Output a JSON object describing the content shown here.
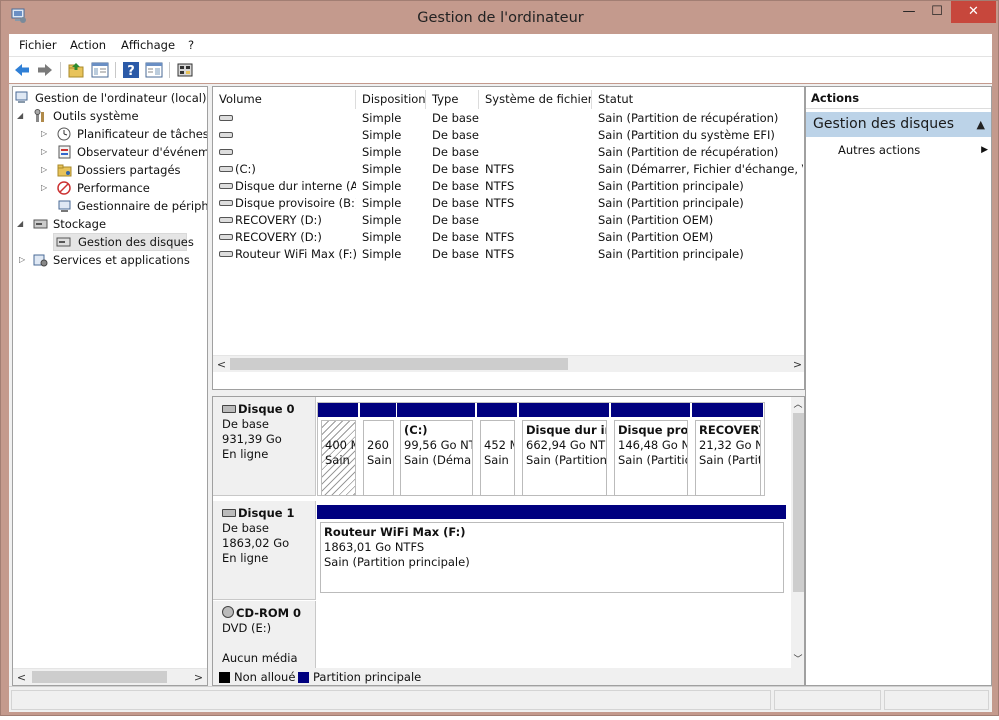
{
  "window": {
    "title": "Gestion de l'ordinateur",
    "minimize_glyph": "—",
    "maximize_glyph": "☐",
    "close_glyph": "✕"
  },
  "menu": [
    "Fichier",
    "Action",
    "Affichage",
    "?"
  ],
  "tree": {
    "root": "Gestion de l'ordinateur (local)",
    "outils": "Outils système",
    "planificateur": "Planificateur de tâches",
    "observateur": "Observateur d'événeme",
    "dossiers": "Dossiers partagés",
    "performance": "Performance",
    "gestionnaire": "Gestionnaire de périphé",
    "stockage": "Stockage",
    "gestion_disques": "Gestion des disques",
    "services": "Services et applications"
  },
  "volumes": {
    "columns": [
      "Volume",
      "Disposition",
      "Type",
      "Système de fichiers",
      "Statut"
    ],
    "rows": [
      [
        "",
        "Simple",
        "De base",
        "",
        "Sain (Partition de récupération)"
      ],
      [
        "",
        "Simple",
        "De base",
        "",
        "Sain (Partition du système EFI)"
      ],
      [
        "",
        "Simple",
        "De base",
        "",
        "Sain (Partition de récupération)"
      ],
      [
        "(C:)",
        "Simple",
        "De base",
        "NTFS",
        "Sain (Démarrer, Fichier d'échange, Vidage"
      ],
      [
        "Disque dur interne (A:)",
        "Simple",
        "De base",
        "NTFS",
        "Sain (Partition principale)"
      ],
      [
        "Disque provisoire (B:)",
        "Simple",
        "De base",
        "NTFS",
        "Sain (Partition principale)"
      ],
      [
        "RECOVERY (D:)",
        "Simple",
        "De base",
        "",
        "Sain (Partition OEM)"
      ],
      [
        "RECOVERY (D:)",
        "Simple",
        "De base",
        "NTFS",
        "Sain (Partition OEM)"
      ],
      [
        "Routeur WiFi Max (F:)",
        "Simple",
        "De base",
        "NTFS",
        "Sain (Partition principale)"
      ]
    ]
  },
  "disks": [
    {
      "name": "Disque 0",
      "type": "De base",
      "size": "931,39 Go",
      "state": "En ligne",
      "partitions": [
        {
          "name": "",
          "size": "400 M",
          "status": "Sain"
        },
        {
          "name": "",
          "size": "260",
          "status": "Sain"
        },
        {
          "name": "(C:)",
          "size": "99,56 Go NT",
          "status": "Sain (Démar"
        },
        {
          "name": "",
          "size": "452 M",
          "status": "Sain"
        },
        {
          "name": "Disque dur int",
          "size": "662,94 Go NTF",
          "status": "Sain (Partition"
        },
        {
          "name": "Disque prov",
          "size": "146,48 Go N",
          "status": "Sain (Partitio"
        },
        {
          "name": "RECOVERY",
          "size": "21,32 Go N",
          "status": "Sain (Partit"
        }
      ]
    },
    {
      "name": "Disque 1",
      "type": "De base",
      "size": "1863,02 Go",
      "state": "En ligne",
      "partitions": [
        {
          "name": "Routeur WiFi Max  (F:)",
          "size": "1863,01 Go NTFS",
          "status": "Sain (Partition principale)"
        }
      ]
    },
    {
      "name": "CD-ROM 0",
      "type": "DVD (E:)",
      "media": "Aucun média"
    }
  ],
  "legend": {
    "unallocated": "Non alloué",
    "primary": "Partition principale"
  },
  "actions": {
    "title": "Actions",
    "section": "Gestion des disques",
    "more": "Autres actions"
  },
  "colors": {
    "window_frame": "#c49a8d",
    "partition_bar": "#00007f",
    "unallocated": "#000000",
    "actions_header": "#bcd3e8",
    "close_button": "#c7473c"
  }
}
